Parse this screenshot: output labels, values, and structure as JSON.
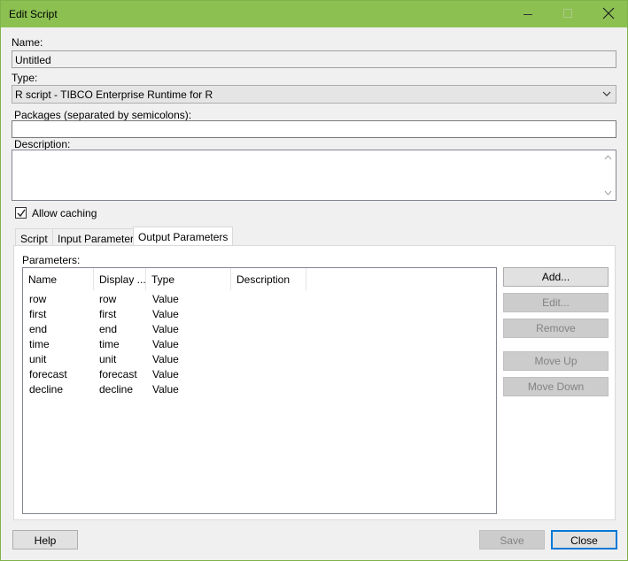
{
  "window": {
    "title": "Edit Script"
  },
  "icons": {
    "minimize": "minimize-icon",
    "maximize": "maximize-icon",
    "close": "close-icon"
  },
  "form": {
    "name_label": "Name:",
    "name_value": "Untitled",
    "type_label": "Type:",
    "type_value": "R script - TIBCO Enterprise Runtime for R",
    "packages_label": "Packages (separated by semicolons):",
    "packages_value": "",
    "description_label": "Description:",
    "description_value": "",
    "allow_caching_label": "Allow caching",
    "allow_caching_checked": true
  },
  "tabs": [
    {
      "label": "Script",
      "active": false
    },
    {
      "label": "Input Parameters",
      "active": false
    },
    {
      "label": "Output Parameters",
      "active": true
    }
  ],
  "parameters": {
    "label": "Parameters:",
    "columns": [
      "Name",
      "Display ...",
      "Type",
      "Description"
    ],
    "rows": [
      [
        "row",
        "row",
        "Value",
        ""
      ],
      [
        "first",
        "first",
        "Value",
        ""
      ],
      [
        "end",
        "end",
        "Value",
        ""
      ],
      [
        "time",
        "time",
        "Value",
        ""
      ],
      [
        "unit",
        "unit",
        "Value",
        ""
      ],
      [
        "forecast",
        "forecast",
        "Value",
        ""
      ],
      [
        "decline",
        "decline",
        "Value",
        ""
      ]
    ]
  },
  "side_buttons": {
    "add": "Add...",
    "edit": "Edit...",
    "remove": "Remove",
    "move_up": "Move Up",
    "move_down": "Move Down"
  },
  "footer": {
    "help": "Help",
    "save": "Save",
    "close": "Close"
  }
}
